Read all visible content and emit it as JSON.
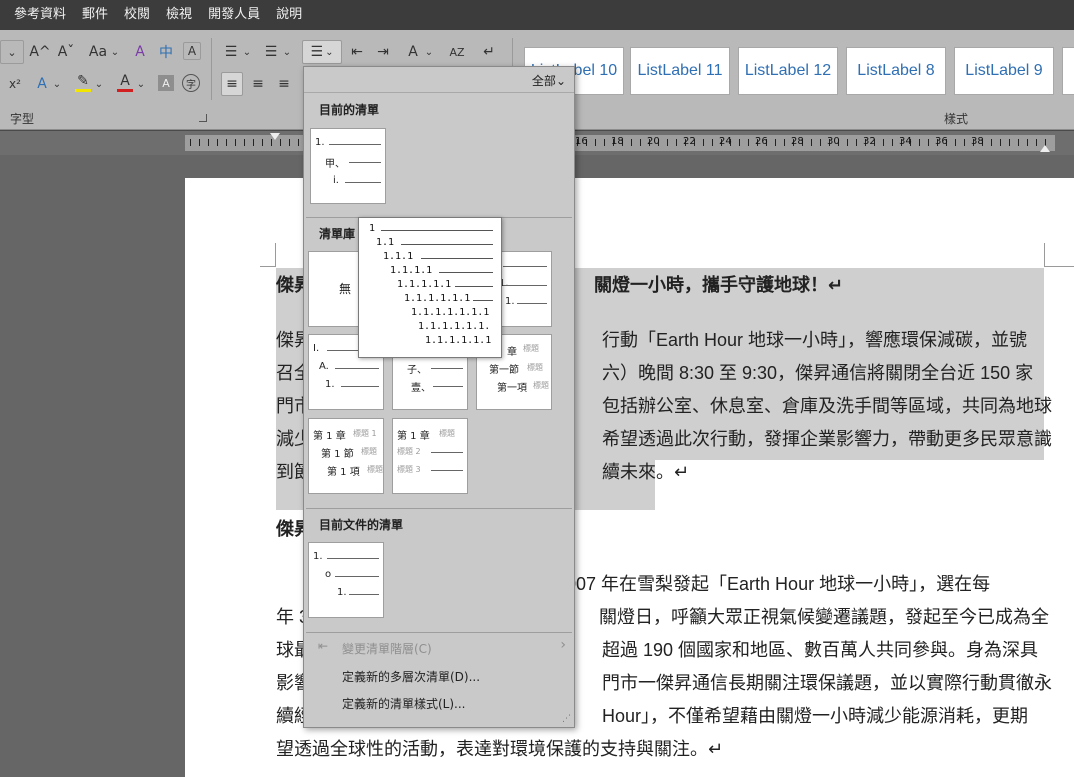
{
  "menubar": [
    "參考資料",
    "郵件",
    "校閱",
    "檢視",
    "開發人員",
    "說明"
  ],
  "ribbon": {
    "font_group_label": "字型",
    "styles_group_label": "樣式",
    "styles": [
      "ListLabel 10",
      "ListLabel 11",
      "ListLabel 12",
      "ListLabel 8",
      "ListLabel 9"
    ],
    "glyphs": {
      "grow_font": "A^",
      "shrink_font": "Aˇ",
      "change_case": "Aa",
      "clear_format": "A",
      "phonetic": "中",
      "char_border": "A",
      "superscript": "x²",
      "text_effect": "A",
      "highlight": "✎",
      "font_color": "A",
      "char_shading": "A",
      "enclose": "字",
      "bullets": "☰",
      "numbering": "☰",
      "multilevel": "☰",
      "decrease_indent": "⇤",
      "increase_indent": "⇥",
      "chinese_layout": "A",
      "sort": "AZ",
      "show_marks": "↵",
      "align_left": "≡",
      "align_center": "≡",
      "align_right": "≡",
      "dropdown": "⌄"
    },
    "highlight_color": "#f2e600",
    "font_color": "#d21f1f"
  },
  "ruler": [
    "16",
    "18",
    "20",
    "22",
    "24",
    "26",
    "28",
    "30",
    "32",
    "34",
    "36",
    "38"
  ],
  "document": {
    "title_prefix": "傑昇",
    "title_suffix": "關燈一小時，攜手守護地球！↵",
    "p1": [
      {
        "prefix": "傑昇",
        "suffix": "行動「Earth Hour 地球一小時」，響應環保減碳，並號"
      },
      {
        "prefix": "召全",
        "suffix": "六）晚間 8:30 至 9:30，傑昇通信將關閉全台近 150 家"
      },
      {
        "prefix": "門市",
        "suffix": "包括辦公室、休息室、倉庫及洗手間等區域，共同為地球"
      },
      {
        "prefix": "減少",
        "suffix": "希望透過此次行動，發揮企業影響力，帶動更多民眾意識"
      },
      {
        "prefix": "到節",
        "suffix": "續未來。↵"
      }
    ],
    "sub_heading": "傑昇",
    "p2": [
      {
        "prefix": "",
        "suffix": "007 年在雪梨發起「Earth Hour 地球一小時」，選在每"
      },
      {
        "prefix": "年 3",
        "suffix": "關燈日，呼籲大眾正視氣候變遷議題，發起至今已成為全"
      },
      {
        "prefix": "球最",
        "suffix": "超過 190 個國家和地區、數百萬人共同參與。身為深具"
      },
      {
        "prefix": "影響",
        "suffix": "門市一傑昇通信長期關注環保議題，並以實際行動貫徹永"
      },
      {
        "prefix": "續經",
        "suffix": "Hour」，不僅希望藉由關燈一小時減少能源消耗，更期"
      },
      {
        "prefix": "",
        "suffix": "望透過全球性的活動，表達對環境保護的支持與關注。↵"
      }
    ]
  },
  "list_panel": {
    "filter": "全部",
    "filter_arrow": "⌄",
    "current_list_title": "目前的清單",
    "library_title": "清單庫",
    "doc_lists_title": "目前文件的清單",
    "none_label": "無",
    "current_thumb": [
      "1.",
      "甲、",
      "i."
    ],
    "lib_a": [
      "I.",
      "A.",
      "1."
    ],
    "lib_b": [
      "子、",
      "壹、"
    ],
    "lib_c": [
      "章",
      "第一節",
      "第一項"
    ],
    "lib_c_grey": [
      "標題",
      "標題",
      "標題"
    ],
    "lib_partial": [
      "1.",
      "1."
    ],
    "lib_d": [
      "第 1 章",
      "第 1 節",
      "第 1 項"
    ],
    "lib_d_grey": [
      "標題 1",
      "標題",
      "標題"
    ],
    "lib_e": [
      "第 1 章"
    ],
    "lib_e_grey": [
      "標題",
      "標題 2",
      "標題 3"
    ],
    "doc_thumb": [
      "1.",
      "o",
      "1."
    ],
    "menu": {
      "change_level": "變更清單階層(C)",
      "define_multilevel": "定義新的多層次清單(D)...",
      "define_style": "定義新的清單樣式(L)...",
      "submenu_arrow": "›",
      "change_level_icon": "⇤"
    },
    "preview": [
      "1",
      "1.1",
      "1.1.1",
      "1.1.1.1",
      "1.1.1.1.1",
      "1.1.1.1.1.1",
      "1.1.1.1.1.1.1",
      "1.1.1.1.1.1.",
      "1.1.1.1.1.1"
    ]
  }
}
